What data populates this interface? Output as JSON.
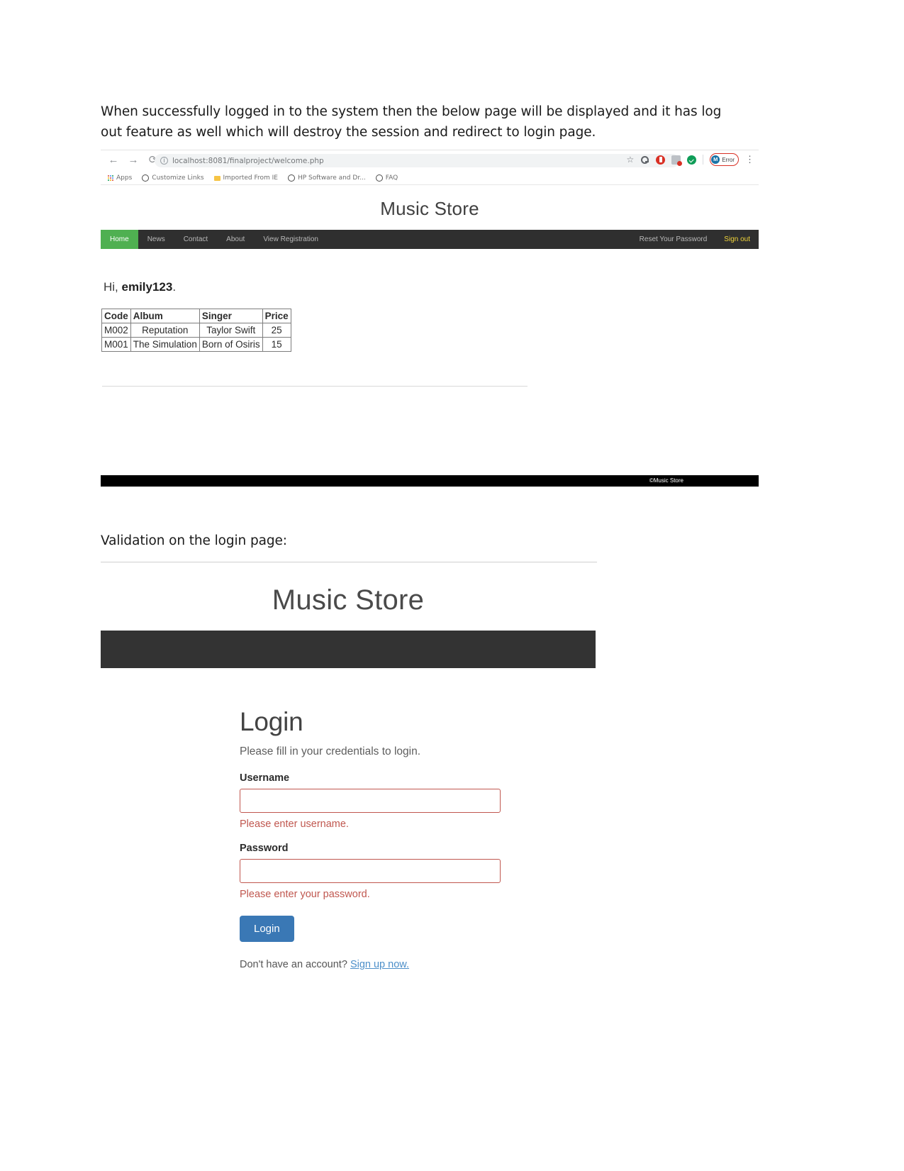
{
  "document": {
    "intro_paragraph": "When successfully logged in to the system then the below page will be displayed and it has log out feature as well which will destroy the session and redirect to login page.",
    "validation_paragraph": "Validation on the login page:"
  },
  "browser": {
    "back_icon": "←",
    "forward_icon": "→",
    "reload_icon": "⟳",
    "site_info_icon": "i",
    "url": "localhost:8081/finalproject/welcome.php",
    "star_icon": "☆",
    "menu_icon": "⋮",
    "profile": {
      "avatar_initial": "M",
      "badge_label": "Error"
    },
    "extensions": [
      {
        "name": "key-extension-icon"
      },
      {
        "name": "opera-extension-icon"
      },
      {
        "name": "shield-extension-icon"
      },
      {
        "name": "checkmark-extension-icon"
      }
    ],
    "bookmarks": [
      {
        "label": "Apps",
        "icon": "apps-grid-icon"
      },
      {
        "label": "Customize Links",
        "icon": "globe-icon"
      },
      {
        "label": "Imported From IE",
        "icon": "folder-icon"
      },
      {
        "label": "HP Software and Dr...",
        "icon": "globe-icon"
      },
      {
        "label": "FAQ",
        "icon": "globe-icon"
      }
    ]
  },
  "welcome_page": {
    "site_title": "Music Store",
    "nav_left": [
      {
        "label": "Home",
        "active": true
      },
      {
        "label": "News",
        "active": false
      },
      {
        "label": "Contact",
        "active": false
      },
      {
        "label": "About",
        "active": false
      },
      {
        "label": "View Registration",
        "active": false
      }
    ],
    "nav_right": [
      {
        "label": "Reset Your Password"
      },
      {
        "label": "Sign out"
      }
    ],
    "greeting_prefix": "Hi, ",
    "greeting_username": "emily123",
    "greeting_suffix": ".",
    "table": {
      "headers": [
        "Code",
        "Album",
        "Singer",
        "Price"
      ],
      "rows": [
        {
          "code": "M002",
          "album": "Reputation",
          "singer": "Taylor Swift",
          "price": "25"
        },
        {
          "code": "M001",
          "album": "The Simulation",
          "singer": "Born of Osiris",
          "price": "15"
        }
      ]
    },
    "footer_text": "©Music Store"
  },
  "login_page": {
    "site_title": "Music Store",
    "heading": "Login",
    "subheading": "Please fill in your credentials to login.",
    "username": {
      "label": "Username",
      "value": "",
      "placeholder": "",
      "error": "Please enter username."
    },
    "password": {
      "label": "Password",
      "value": "",
      "placeholder": "",
      "error": "Please enter your password."
    },
    "submit_label": "Login",
    "signup_prompt": "Don't have an account? ",
    "signup_link": "Sign up now."
  },
  "colors": {
    "nav_dark": "#2f2f2f",
    "nav_active_green": "#4fb051",
    "signout_yellow": "#f0d43a",
    "error_red": "#c0574f",
    "login_blue": "#3a78b5"
  }
}
